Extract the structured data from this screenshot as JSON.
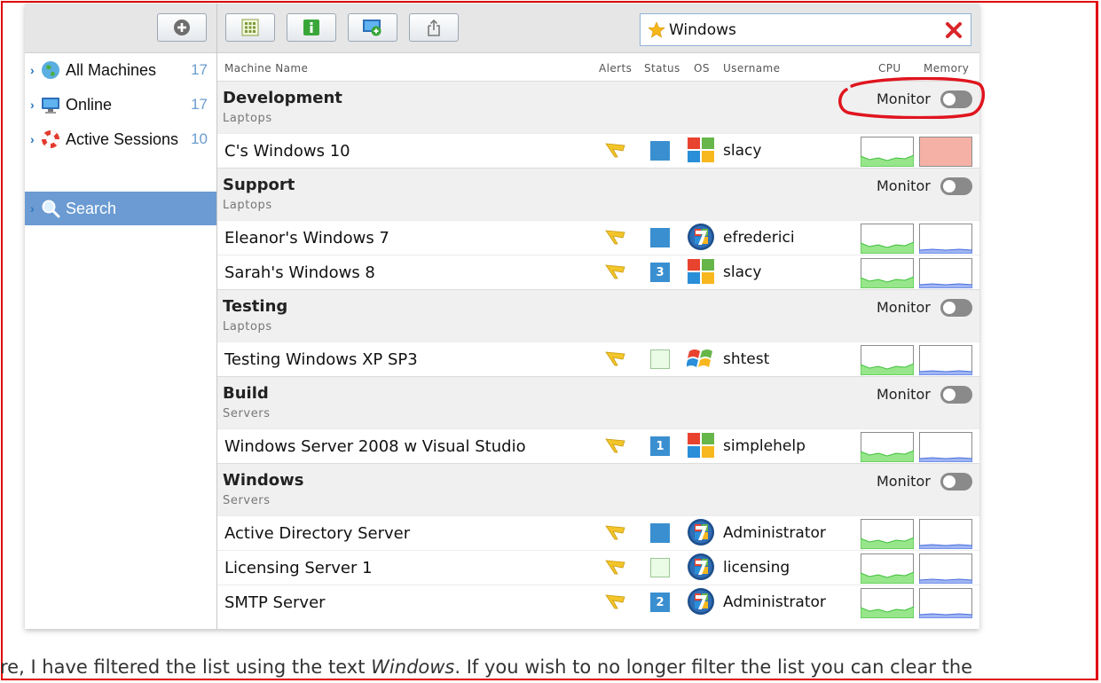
{
  "sidebar": {
    "items": [
      {
        "label": "All Machines",
        "count": "17",
        "icon": "globe-icon"
      },
      {
        "label": "Online",
        "count": "17",
        "icon": "monitor-icon"
      },
      {
        "label": "Active Sessions",
        "count": "10",
        "icon": "lifebuoy-icon"
      }
    ],
    "search_label": "Search"
  },
  "toolbar": {
    "buttons": [
      "grid-icon",
      "info-icon",
      "add-screen-icon",
      "share-icon"
    ],
    "add_icon": "plus-circle-icon"
  },
  "filter": {
    "value": "Windows",
    "star_icon": "star-icon",
    "clear_icon": "clear-x-icon"
  },
  "columns": {
    "machine_name": "Machine Name",
    "alerts": "Alerts",
    "status": "Status",
    "os": "OS",
    "username": "Username",
    "cpu": "CPU",
    "memory": "Memory"
  },
  "groups": [
    {
      "name": "Development",
      "type": "Laptops",
      "monitor_label": "Monitor",
      "machines": [
        {
          "name": "C's Windows 10",
          "status": "blue",
          "status_text": "",
          "os": "windows10",
          "user": "slacy",
          "mem_alert": true
        }
      ]
    },
    {
      "name": "Support",
      "type": "Laptops",
      "monitor_label": "Monitor",
      "machines": [
        {
          "name": "Eleanor's Windows 7",
          "status": "blue",
          "status_text": "",
          "os": "windows7",
          "user": "efrederici"
        },
        {
          "name": "Sarah's Windows 8",
          "status": "blue",
          "status_text": "3",
          "os": "windows10",
          "user": "slacy"
        }
      ]
    },
    {
      "name": "Testing",
      "type": "Laptops",
      "monitor_label": "Monitor",
      "machines": [
        {
          "name": "Testing Windows XP SP3",
          "status": "empty",
          "status_text": "",
          "os": "windowsxp",
          "user": "shtest"
        }
      ]
    },
    {
      "name": "Build",
      "type": "Servers",
      "monitor_label": "Monitor",
      "machines": [
        {
          "name": "Windows Server 2008 w Visual Studio",
          "status": "blue",
          "status_text": "1",
          "os": "windows10",
          "user": "simplehelp"
        }
      ]
    },
    {
      "name": "Windows",
      "type": "Servers",
      "monitor_label": "Monitor",
      "machines": [
        {
          "name": "Active Directory Server",
          "status": "blue",
          "status_text": "",
          "os": "windows7",
          "user": "Administrator"
        },
        {
          "name": "Licensing Server 1",
          "status": "empty",
          "status_text": "",
          "os": "windows7",
          "user": "licensing"
        },
        {
          "name": "SMTP Server",
          "status": "blue",
          "status_text": "2",
          "os": "windows7",
          "user": "Administrator"
        }
      ]
    }
  ],
  "caption": {
    "before": "re, I have filtered the list using the text ",
    "emphasis": "Windows",
    "after": ". If you wish to no longer filter the list you can clear the"
  },
  "colors": {
    "accent": "#6b9bd2",
    "annotation": "#e0141e",
    "frame": "#e00000"
  }
}
